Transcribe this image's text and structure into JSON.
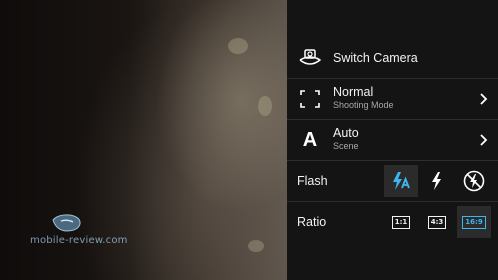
{
  "watermark": {
    "text": "mobile-review.com"
  },
  "menu": {
    "switch_camera": {
      "label": "Switch Camera",
      "icon": "switch-camera-icon"
    },
    "shooting_mode": {
      "label": "Normal",
      "sublabel": "Shooting Mode",
      "icon": "focus-frame-icon"
    },
    "scene": {
      "label": "Auto",
      "sublabel": "Scene",
      "icon_glyph": "A"
    },
    "flash": {
      "label": "Flash",
      "options": [
        {
          "name": "flash-auto",
          "selected": true
        },
        {
          "name": "flash-on",
          "selected": false
        },
        {
          "name": "flash-off",
          "selected": false
        }
      ]
    },
    "ratio": {
      "label": "Ratio",
      "options": [
        {
          "text": "1:1",
          "selected": false
        },
        {
          "text": "4:3",
          "selected": false
        },
        {
          "text": "16:9",
          "selected": true
        }
      ]
    }
  },
  "colors": {
    "accent": "#3fb6f0",
    "panel": "#141414",
    "divider": "#2e2e2e"
  }
}
